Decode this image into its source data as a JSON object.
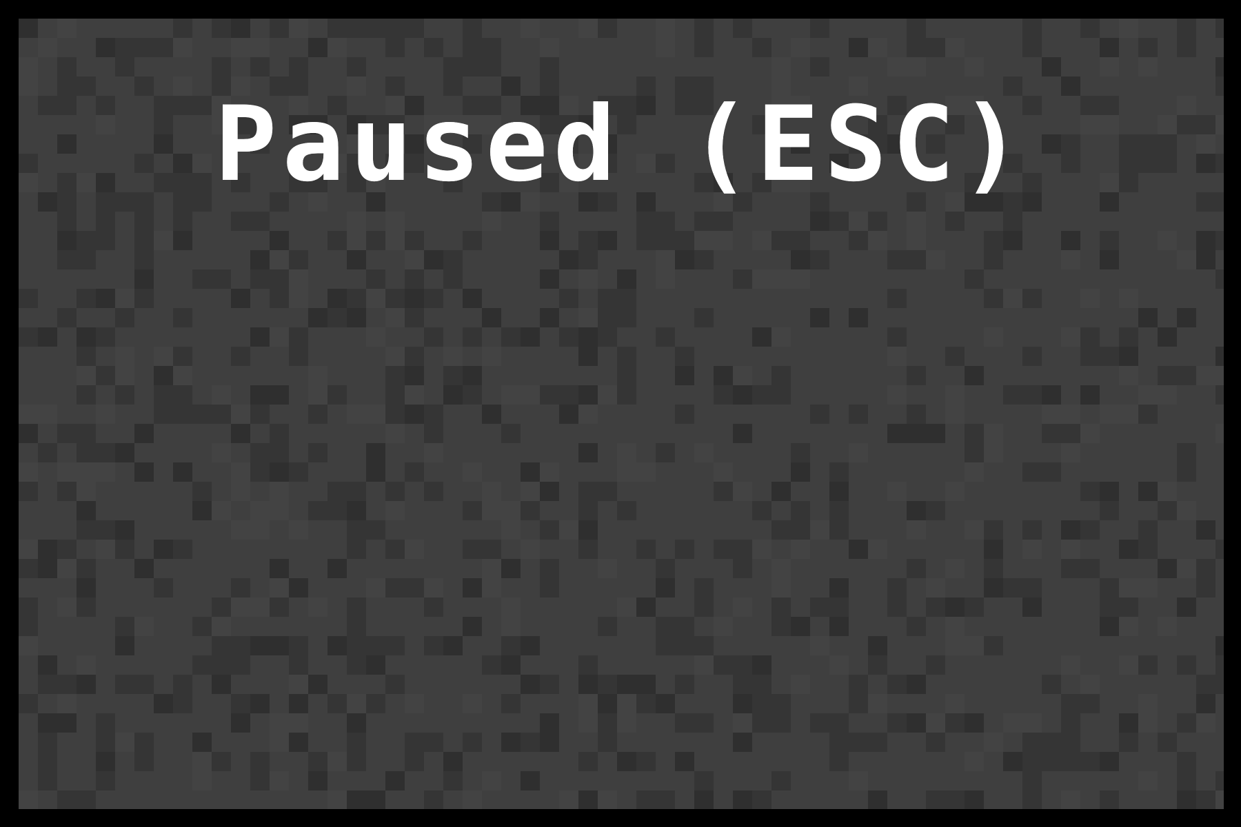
{
  "game": {
    "pause_label": "Paused (ESC)"
  },
  "colors": {
    "frame": "#000000",
    "background": "#3f3f3f",
    "noise_dark": "#353535",
    "noise_darker": "#2f2f2f",
    "noise_light": "#434343",
    "text": "#ffffff"
  }
}
